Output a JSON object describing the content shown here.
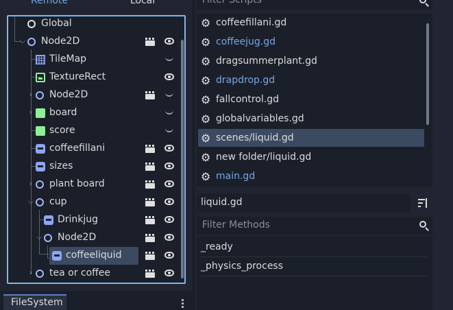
{
  "scene_tabs": {
    "remote": "Remote",
    "local": "Local"
  },
  "tree": {
    "items": [
      {
        "label": "Global"
      },
      {
        "label": "Node2D"
      },
      {
        "label": "TileMap"
      },
      {
        "label": "TextureRect"
      },
      {
        "label": "Node2D"
      },
      {
        "label": "board"
      },
      {
        "label": "score"
      },
      {
        "label": "coffeefillani"
      },
      {
        "label": "sizes"
      },
      {
        "label": "plant board"
      },
      {
        "label": "cup"
      },
      {
        "label": "Drinkjug"
      },
      {
        "label": "Node2D"
      },
      {
        "label": "coffeeliquid"
      },
      {
        "label": "tea or coffee"
      }
    ]
  },
  "bottom_dock": {
    "filesystem_tab": "FileSystem"
  },
  "scripts": {
    "filter_placeholder": "Filter Scripts",
    "items": [
      {
        "label": "coffeefillani.gd"
      },
      {
        "label": "coffeejug.gd"
      },
      {
        "label": "dragsummerplant.gd"
      },
      {
        "label": "drapdrop.gd"
      },
      {
        "label": "fallcontrol.gd"
      },
      {
        "label": "globalvariables.gd"
      },
      {
        "label": "scenes/liquid.gd"
      },
      {
        "label": "new folder/liquid.gd"
      },
      {
        "label": "main.gd"
      }
    ]
  },
  "current_script": {
    "name": "liquid.gd"
  },
  "methods": {
    "filter_placeholder": "Filter Methods",
    "items": [
      {
        "label": "_ready"
      },
      {
        "label": "_physics_process"
      }
    ]
  },
  "colors": {
    "accent": "#80b6f0",
    "modified_script": "#77a6e3",
    "selected_row": "#3b4a60"
  }
}
